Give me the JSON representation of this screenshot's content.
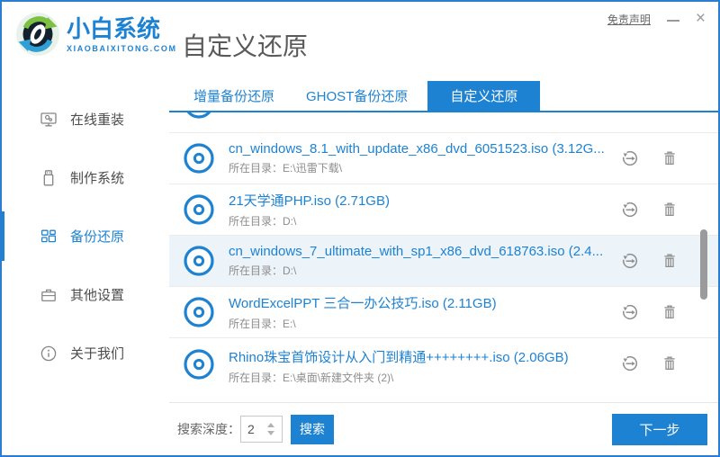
{
  "titlebar": {
    "disclaimer": "免责声明",
    "minimize": "—",
    "close": "×"
  },
  "brand": {
    "name": "小白系统",
    "domain": "XIAOBAIXITONG.COM"
  },
  "page_title": "自定义还原",
  "sidebar": {
    "items": [
      {
        "label": "在线重装",
        "icon": "monitor-icon",
        "active": false
      },
      {
        "label": "制作系统",
        "icon": "usb-icon",
        "active": false
      },
      {
        "label": "备份还原",
        "icon": "blocks-icon",
        "active": true
      },
      {
        "label": "其他设置",
        "icon": "toolbox-icon",
        "active": false
      },
      {
        "label": "关于我们",
        "icon": "info-icon",
        "active": false
      }
    ]
  },
  "tabs": [
    {
      "label": "增量备份还原",
      "active": false
    },
    {
      "label": "GHOST备份还原",
      "active": false
    },
    {
      "label": "自定义还原",
      "active": true
    }
  ],
  "list": {
    "dir_label": "所在目录：",
    "items": [
      {
        "name": "cn_windows_8.1_with_update_x86_dvd_6051523.iso (3.12G...",
        "dir": "E:\\迅雷下载\\",
        "highlighted": false
      },
      {
        "name": "21天学通PHP.iso (2.71GB)",
        "dir": "D:\\",
        "highlighted": false
      },
      {
        "name": "cn_windows_7_ultimate_with_sp1_x86_dvd_618763.iso (2.4...",
        "dir": "D:\\",
        "highlighted": true
      },
      {
        "name": "WordExcelPPT 三合一办公技巧.iso (2.11GB)",
        "dir": "E:\\",
        "highlighted": false
      },
      {
        "name": "Rhino珠宝首饰设计从入门到精通++++++++.iso (2.06GB)",
        "dir": "E:\\桌面\\新建文件夹 (2)\\",
        "highlighted": false
      }
    ]
  },
  "footer": {
    "depth_label": "搜索深度：",
    "depth_value": "2",
    "search_button": "搜索",
    "next_button": "下一步"
  },
  "colors": {
    "primary": "#1e82d2",
    "window_border": "#2a7dd1",
    "highlight_row": "#ecf3f9"
  }
}
